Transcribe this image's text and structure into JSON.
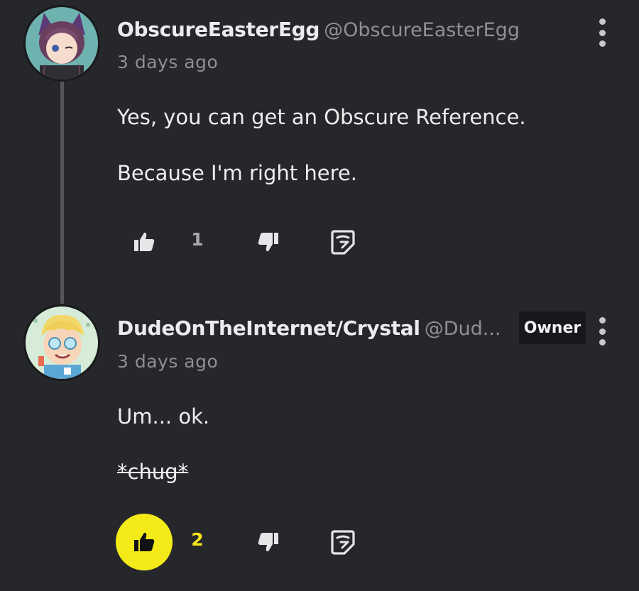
{
  "colors": {
    "background": "#26272b",
    "accent_like": "#f4ea19",
    "muted_text": "#8e8f93",
    "badge_bg": "#17181b"
  },
  "comments": [
    {
      "username": "ObscureEasterEgg",
      "handle": "@ObscureEasterEgg",
      "time": "3 days ago",
      "paragraphs": [
        "Yes, you can get an Obscure Reference.",
        "Because I'm right here."
      ],
      "like_count": "1",
      "liked": false,
      "icons": [
        "thumbs-up-icon",
        "thumbs-down-icon",
        "reply-icon",
        "more-vertical-icon"
      ]
    },
    {
      "username": "DudeOnTheInternet/Crystal",
      "handle": "@Dud...",
      "badge": "Owner",
      "time": "3 days ago",
      "paragraphs": [
        "Um... ok.",
        "*chug*"
      ],
      "like_count": "2",
      "liked": true,
      "icons": [
        "thumbs-up-icon",
        "thumbs-down-icon",
        "reply-icon",
        "more-vertical-icon"
      ]
    }
  ]
}
